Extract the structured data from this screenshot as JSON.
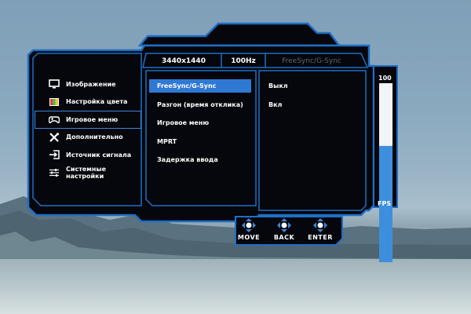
{
  "osd": {
    "info_tabs": {
      "resolution": "3440x1440",
      "refresh_rate": "100Hz",
      "mode": "FreeSync/G-Sync"
    },
    "main_menu": [
      {
        "label": "Изображение",
        "icon": "monitor-icon"
      },
      {
        "label": "Настройка цвета",
        "icon": "color-palette-icon"
      },
      {
        "label": "Игровое меню",
        "icon": "gamepad-icon",
        "selected": true
      },
      {
        "label": "Дополнительно",
        "icon": "tools-icon"
      },
      {
        "label": "Источник сигнала",
        "icon": "input-source-icon"
      },
      {
        "label": "Системные настройки",
        "icon": "sliders-icon"
      }
    ],
    "submenu": [
      {
        "label": "FreeSync/G-Sync",
        "selected": true
      },
      {
        "label": "Разгон (время отклика)"
      },
      {
        "label": "Игровое меню"
      },
      {
        "label": "MPRT"
      },
      {
        "label": "Задержка ввода"
      }
    ],
    "values": [
      "Выкл",
      "Вкл"
    ],
    "fps_meter": {
      "max_label": "100",
      "label": "FPS",
      "level": 0.65
    },
    "navigation": [
      {
        "label": "MOVE",
        "icon": "four-way-arrow-icon"
      },
      {
        "label": "BACK",
        "icon": "four-way-arrow-icon"
      },
      {
        "label": "ENTER",
        "icon": "four-way-arrow-icon"
      }
    ],
    "colors": {
      "accent": "#2f79d4",
      "frame": "#1f6fc4",
      "panel": "#05070c"
    }
  }
}
